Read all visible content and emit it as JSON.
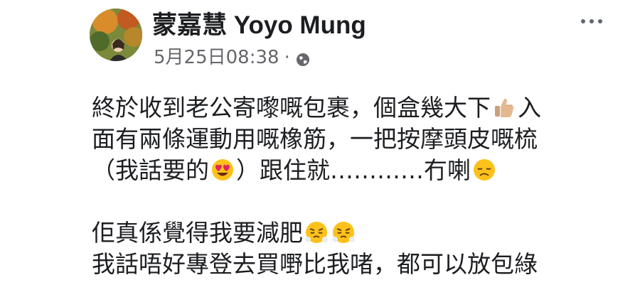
{
  "post": {
    "author": "蒙嘉慧 Yoyo Mung",
    "timestamp": "5月25日08:38",
    "separator": "·",
    "privacy_icon": "globe-icon",
    "menu_icon": "more-options-icon",
    "body": {
      "line1": "終於收到老公寄嚟嘅包裹，個盒幾大下",
      "line1b": "入",
      "line2": "面有兩條運動用嘅橡筋，一把按摩頭皮嘅梳",
      "line3a": "（我話要的",
      "line3b": "）跟住就…………冇喇",
      "line4": "佢真係覺得我要減肥",
      "line5": "我話唔好專登去買嘢比我啫，都可以放包綠"
    },
    "emojis": {
      "thumbs_up": "thumbs-up-icon",
      "heart_eyes": "heart-eyes-icon",
      "disappointed": "disappointed-face-icon",
      "huffing": "face-with-steam-icon"
    }
  }
}
